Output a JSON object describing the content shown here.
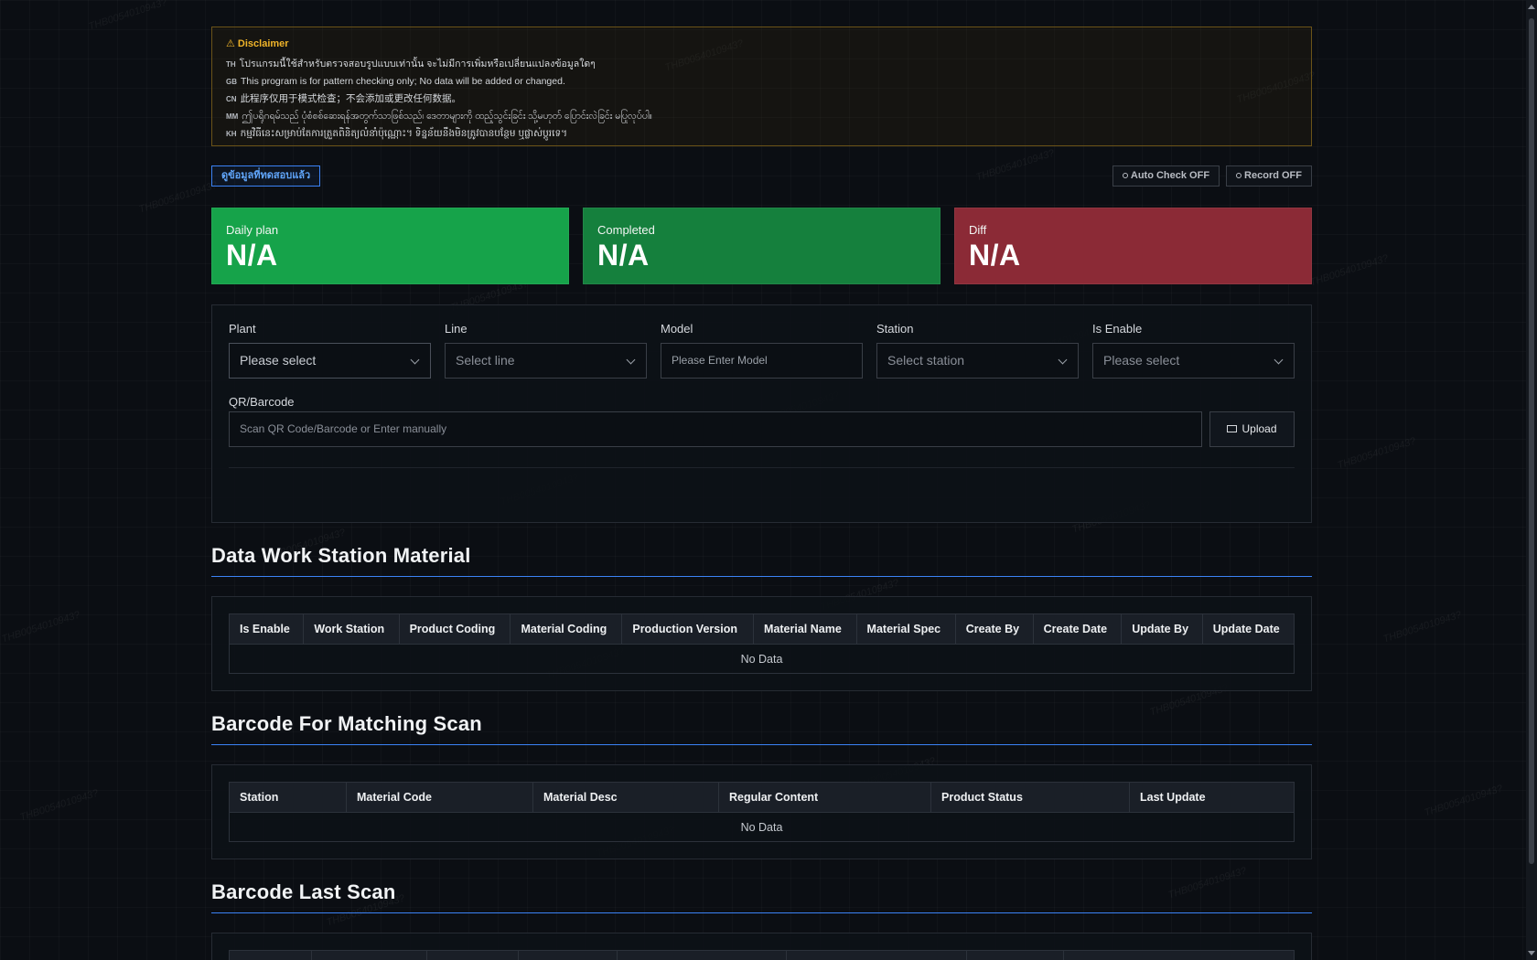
{
  "disclaimer": {
    "title": "⚠ Disclaimer",
    "lines": [
      {
        "code": "TH",
        "text": "โปรแกรมนี้ใช้สำหรับตรวจสอบรูปแบบเท่านั้น จะไม่มีการเพิ่มหรือเปลี่ยนแปลงข้อมูลใดๆ"
      },
      {
        "code": "GB",
        "text": "This program is for pattern checking only; No data will be added or changed."
      },
      {
        "code": "CN",
        "text": "此程序仅用于模式检查；不会添加或更改任何数据。"
      },
      {
        "code": "MM",
        "text": "ဤပရိုဂရမ်သည် ပုံစံစစ်ဆေးရန်အတွက်သာဖြစ်သည်၊ ဒေတာများကို ထည့်သွင်းခြင်း သို့မဟုတ် ပြောင်းလဲခြင်း မပြုလုပ်ပါ။"
      },
      {
        "code": "KH",
        "text": "កម្មវិធីនេះសម្រាប់តែការត្រួតពិនិត្យលំនាំប៉ុណ្ណោះ។ ទិន្នន័យនឹងមិនត្រូវបានបន្ថែម ឬផ្លាស់ប្តូរទេ។"
      }
    ]
  },
  "toolbar": {
    "tested_label": "ดูข้อมูลที่ทดสอบแล้ว",
    "auto_check_label": "Auto Check OFF",
    "record_label": "Record OFF"
  },
  "stats": {
    "plan": {
      "label": "Daily plan",
      "value": "N/A"
    },
    "completed": {
      "label": "Completed",
      "value": "N/A"
    },
    "diff": {
      "label": "Diff",
      "value": "N/A"
    }
  },
  "form": {
    "plant": {
      "label": "Plant",
      "value": "Please select"
    },
    "line": {
      "label": "Line",
      "value": "Select line"
    },
    "model": {
      "label": "Model",
      "placeholder": "Please Enter Model"
    },
    "station": {
      "label": "Station",
      "value": "Select station"
    },
    "is_enable": {
      "label": "Is Enable",
      "value": "Please select"
    },
    "qr": {
      "label": "QR/Barcode",
      "placeholder": "Scan QR Code/Barcode or Enter manually"
    },
    "upload_label": "Upload"
  },
  "sections": {
    "material": {
      "title": "Data Work Station Material",
      "columns": [
        "Is Enable",
        "Work Station",
        "Product Coding",
        "Material Coding",
        "Production Version",
        "Material Name",
        "Material Spec",
        "Create By",
        "Create Date",
        "Update By",
        "Update Date"
      ],
      "empty": "No Data"
    },
    "matching": {
      "title": "Barcode For Matching Scan",
      "columns": [
        "Station",
        "Material Code",
        "Material Desc",
        "Regular Content",
        "Product Status",
        "Last Update"
      ],
      "empty": "No Data"
    },
    "last_scan": {
      "title": "Barcode Last Scan"
    }
  },
  "colors": {
    "plan": "#16a34a",
    "completed": "#15803d",
    "diff": "#8b2a36",
    "accent": "#3b82f6",
    "warning": "#f0b429"
  },
  "watermark": "THB0054010943?"
}
